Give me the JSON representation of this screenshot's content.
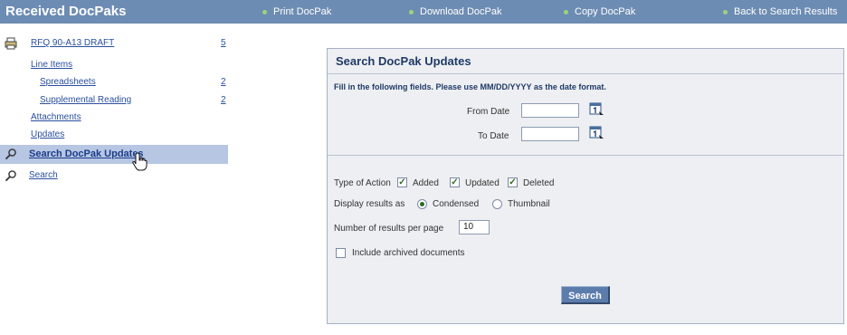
{
  "header": {
    "title": "Received DocPaks",
    "links": [
      {
        "label": "Print DocPak"
      },
      {
        "label": "Download DocPak"
      },
      {
        "label": "Copy DocPak"
      },
      {
        "label": "Back to Search Results"
      }
    ],
    "accent_color": "#6d8cb3"
  },
  "sidebar": {
    "items": [
      {
        "label": "RFQ 90-A13 DRAFT",
        "count": "5",
        "icon": "printer-icon"
      },
      {
        "label": "Line Items"
      },
      {
        "label": "Spreadsheets",
        "count": "2"
      },
      {
        "label": "Supplemental Reading",
        "count": "2"
      },
      {
        "label": "Attachments"
      },
      {
        "label": "Updates"
      },
      {
        "label": "Search DocPak Updates",
        "icon": "search-icon",
        "active": true
      },
      {
        "label": "Search",
        "icon": "search-icon"
      }
    ]
  },
  "panel": {
    "title": "Search DocPak Updates",
    "instructions": "Fill in the following fields. Please use MM/DD/YYYY as the date format.",
    "from_label": "From Date",
    "from_value": "",
    "to_label": "To Date",
    "to_value": "",
    "type_label": "Type of Action",
    "types": [
      {
        "label": "Added",
        "checked": true
      },
      {
        "label": "Updated",
        "checked": true
      },
      {
        "label": "Deleted",
        "checked": true
      }
    ],
    "display_label": "Display results as",
    "display_options": [
      {
        "label": "Condensed",
        "selected": true
      },
      {
        "label": "Thumbnail",
        "selected": false
      }
    ],
    "per_page_label": "Number of results per page",
    "per_page_value": "10",
    "archived_label": "Include archived documents",
    "archived_checked": false,
    "search_button": "Search"
  }
}
